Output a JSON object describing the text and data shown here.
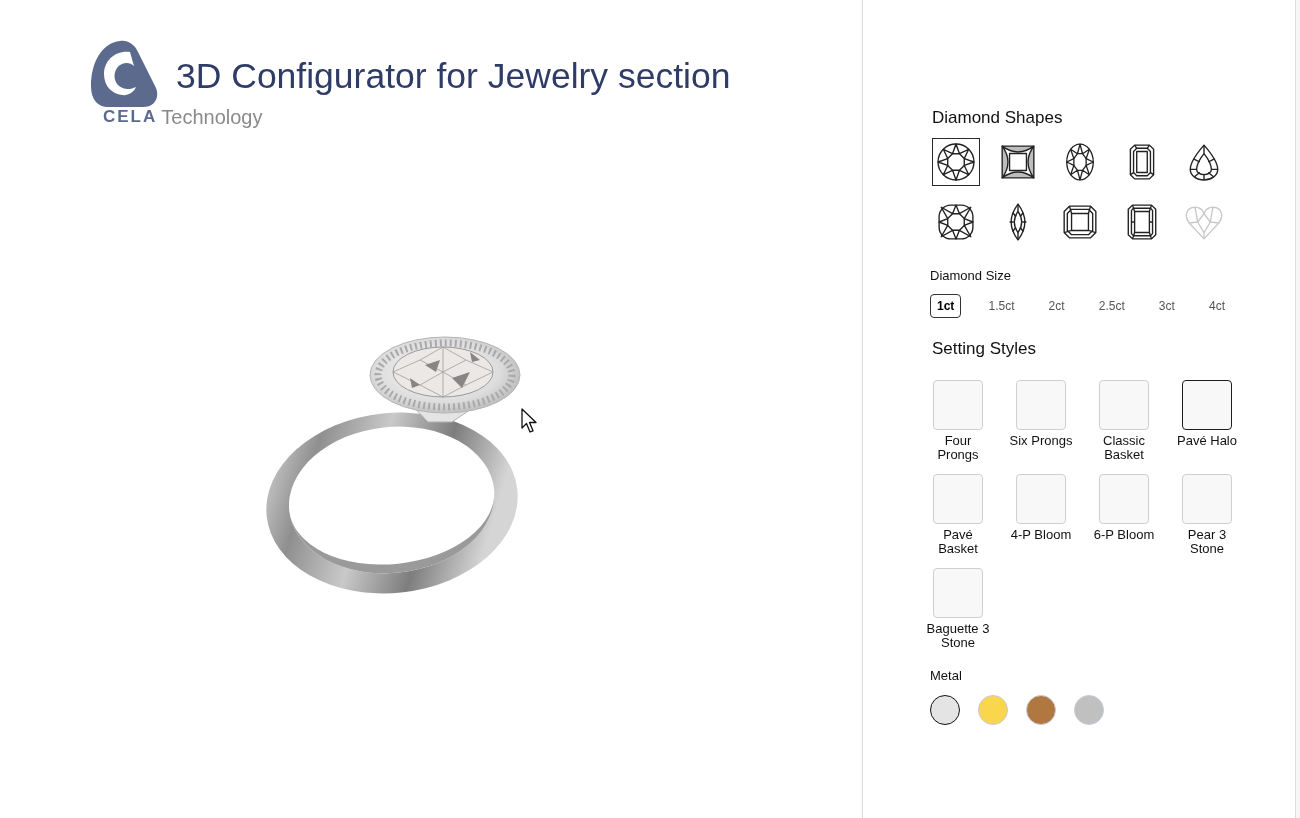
{
  "header": {
    "logo": {
      "wordmark": "CELA",
      "tagline": "Technology"
    },
    "title": "3D Configurator for Jewelry section"
  },
  "panel": {
    "diamond_shapes": {
      "title": "Diamond Shapes",
      "items": [
        {
          "kind": "round",
          "selected": true,
          "disabled": false
        },
        {
          "kind": "princess",
          "selected": false,
          "disabled": false
        },
        {
          "kind": "oval",
          "selected": false,
          "disabled": false
        },
        {
          "kind": "emerald",
          "selected": false,
          "disabled": false
        },
        {
          "kind": "pear",
          "selected": false,
          "disabled": false
        },
        {
          "kind": "cushion",
          "selected": false,
          "disabled": false
        },
        {
          "kind": "marquise",
          "selected": false,
          "disabled": false
        },
        {
          "kind": "asscher",
          "selected": false,
          "disabled": false
        },
        {
          "kind": "radiant",
          "selected": false,
          "disabled": false
        },
        {
          "kind": "heart",
          "selected": false,
          "disabled": true
        }
      ]
    },
    "diamond_size": {
      "title": "Diamond Size",
      "options": [
        {
          "label": "1ct",
          "selected": true
        },
        {
          "label": "1.5ct",
          "selected": false
        },
        {
          "label": "2ct",
          "selected": false
        },
        {
          "label": "2.5ct",
          "selected": false
        },
        {
          "label": "3ct",
          "selected": false
        },
        {
          "label": "4ct",
          "selected": false
        }
      ]
    },
    "setting_styles": {
      "title": "Setting Styles",
      "items": [
        {
          "label": "Four Prongs",
          "selected": false
        },
        {
          "label": "Six Prongs",
          "selected": false
        },
        {
          "label": "Classic Basket",
          "selected": false
        },
        {
          "label": "Pavé Halo",
          "selected": true
        },
        {
          "label": "Pavé Basket",
          "selected": false
        },
        {
          "label": "4-P Bloom",
          "selected": false
        },
        {
          "label": "6-P Bloom",
          "selected": false
        },
        {
          "label": "Pear 3 Stone",
          "selected": false
        },
        {
          "label": "Baguette 3 Stone",
          "selected": false
        }
      ]
    },
    "metal": {
      "title": "Metal",
      "swatches": [
        {
          "color": "#e4e4e4",
          "selected": true
        },
        {
          "color": "#f9d64c",
          "selected": false
        },
        {
          "color": "#b07840",
          "selected": false
        },
        {
          "color": "#c0c0c0",
          "selected": false
        }
      ]
    }
  }
}
